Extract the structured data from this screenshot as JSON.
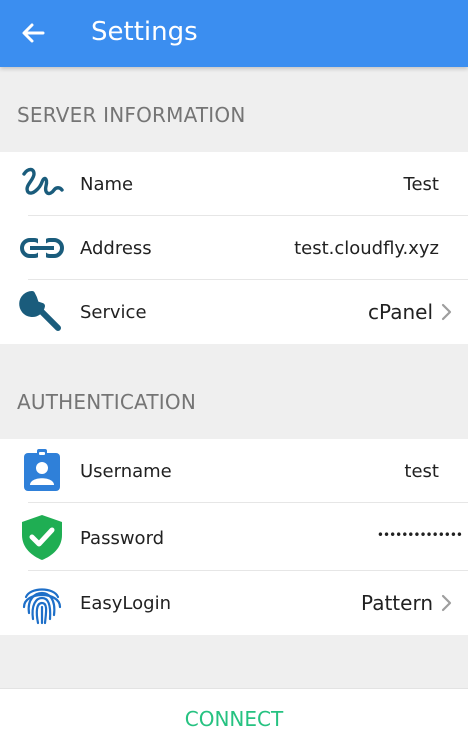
{
  "header": {
    "title": "Settings",
    "back_icon": "arrow-left-icon",
    "color": "#3b8ef0"
  },
  "sections": {
    "server": {
      "label": "SERVER INFORMATION",
      "rows": {
        "name": {
          "label": "Name",
          "value": "Test",
          "icon": "squiggle-icon"
        },
        "address": {
          "label": "Address",
          "value": "test.cloudfly.xyz",
          "icon": "link-icon"
        },
        "service": {
          "label": "Service",
          "value": "cPanel",
          "icon": "wrench-icon"
        }
      }
    },
    "auth": {
      "label": "AUTHENTICATION",
      "rows": {
        "username": {
          "label": "Username",
          "value": "test",
          "icon": "badge-icon"
        },
        "password": {
          "label": "Password",
          "value": "••••••••••••••",
          "icon": "shield-check-icon"
        },
        "easylogin": {
          "label": "EasyLogin",
          "value": "Pattern",
          "icon": "fingerprint-icon"
        }
      }
    }
  },
  "footer": {
    "connect_label": "CONNECT",
    "accent": "#26c281"
  }
}
